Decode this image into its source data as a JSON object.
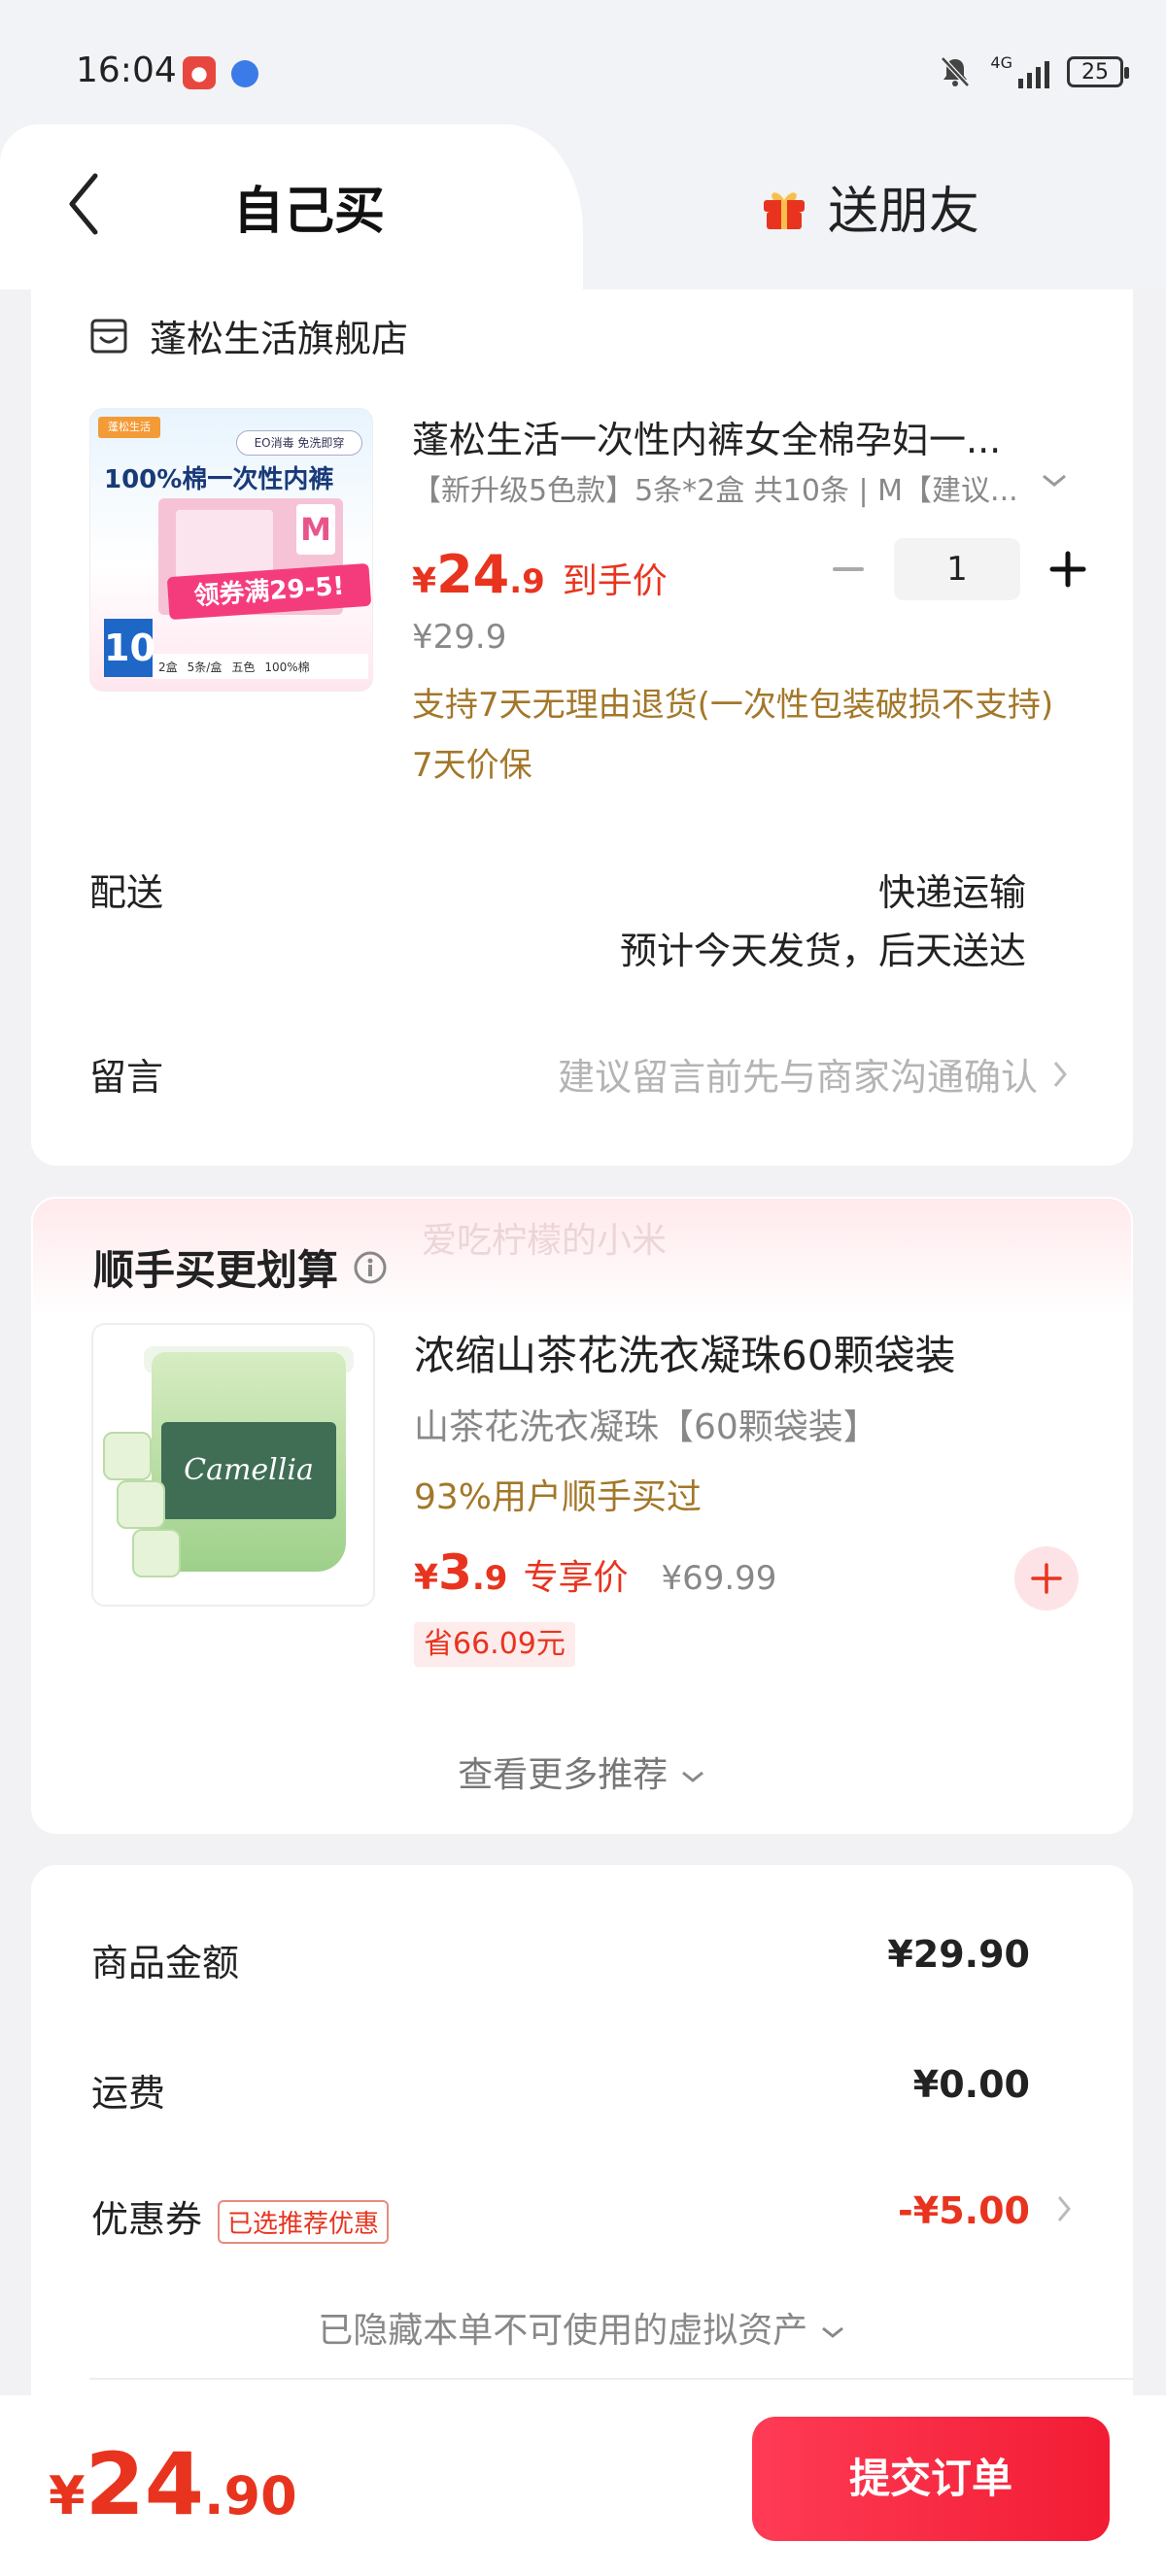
{
  "status_bar": {
    "time": "16:04",
    "network": "4G",
    "battery": "25"
  },
  "tabs": {
    "self_buy": "自己买",
    "gift_friend": "送朋友"
  },
  "store": {
    "name": "蓬松生活旗舰店"
  },
  "product": {
    "title": "蓬松生活一次性内裤女全棉孕妇一...",
    "spec": "【新升级5色款】5条*2盒 共10条 | M【建议...",
    "price_symbol": "¥",
    "price_int": "24",
    "price_dec": ".9",
    "price_tag": "到手价",
    "quantity": "1",
    "original_price": "¥29.9",
    "policy_return": "支持7天无理由退货(一次性包装破损不支持)",
    "policy_price": "7天价保",
    "image": {
      "brand": "蓬松生活",
      "tag": "EO消毒 免洗即穿",
      "headline": "100%棉一次性内裤",
      "coupon": "领券满29-5!",
      "size": "M",
      "count": "10",
      "bottom": [
        "2盒",
        "5条/盒",
        "五色",
        "100%棉"
      ]
    }
  },
  "shipping": {
    "label": "配送",
    "method": "快递运输",
    "estimate": "预计今天发货，后天送达"
  },
  "message": {
    "label": "留言",
    "placeholder": "建议留言前先与商家沟通确认"
  },
  "recommend": {
    "watermark": "爱吃柠檬的小米",
    "title": "顺手买更划算",
    "name": "浓缩山茶花洗衣凝珠60颗袋装",
    "spec": "山茶花洗衣凝珠【60颗袋装】",
    "social_proof": "93%用户顺手买过",
    "price_symbol": "¥",
    "price_int": "3",
    "price_dec": ".9",
    "price_tag": "专享价",
    "original_price": "¥69.99",
    "save": "省66.09元",
    "image_label": "Camellia",
    "more": "查看更多推荐"
  },
  "summary": {
    "goods_label": "商品金额",
    "goods_value": "¥29.90",
    "freight_label": "运费",
    "freight_value": "¥0.00",
    "coupon_label": "优惠券",
    "coupon_badge": "已选推荐优惠",
    "coupon_value": "-¥5.00",
    "hidden_assets": "已隐藏本单不可使用的虚拟资产"
  },
  "footer": {
    "total_symbol": "¥",
    "total_int": "24",
    "total_dec": ".90",
    "submit": "提交订单"
  },
  "colors": {
    "accent": "#e8341f",
    "policy": "#a3772a",
    "submit": "#f21c34"
  }
}
